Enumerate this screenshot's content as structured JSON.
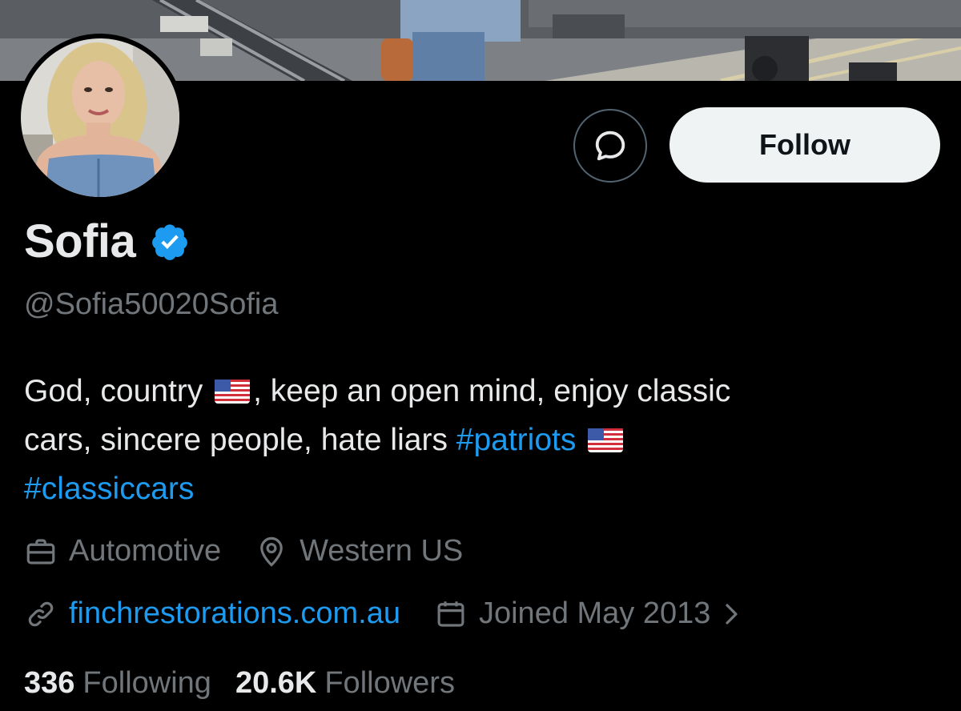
{
  "profile": {
    "display_name": "Sofia",
    "handle": "@Sofia50020Sofia",
    "verified": true,
    "verified_color": "#1d9bf0"
  },
  "actions": {
    "message_icon": "message-icon",
    "follow_label": "Follow"
  },
  "bio": {
    "line1_a": "God, country",
    "line1_b": ", keep an open mind, enjoy classic",
    "line2_a": "cars, sincere people, hate liars ",
    "hashtag1": "#patriots",
    "hashtag2": "#classiccars"
  },
  "meta": {
    "category_icon": "briefcase-icon",
    "category": "Automotive",
    "location_icon": "location-pin-icon",
    "location": "Western US",
    "website_icon": "link-icon",
    "website": "finchrestorations.com.au",
    "joined_icon": "calendar-icon",
    "joined": "Joined May 2013"
  },
  "stats": {
    "following_count": "336",
    "following_label": "Following",
    "followers_count": "20.6K",
    "followers_label": "Followers"
  },
  "colors": {
    "background": "#000000",
    "text_primary": "#e7e9ea",
    "text_secondary": "#71767b",
    "accent": "#1d9bf0",
    "follow_button_bg": "#eff3f4"
  }
}
